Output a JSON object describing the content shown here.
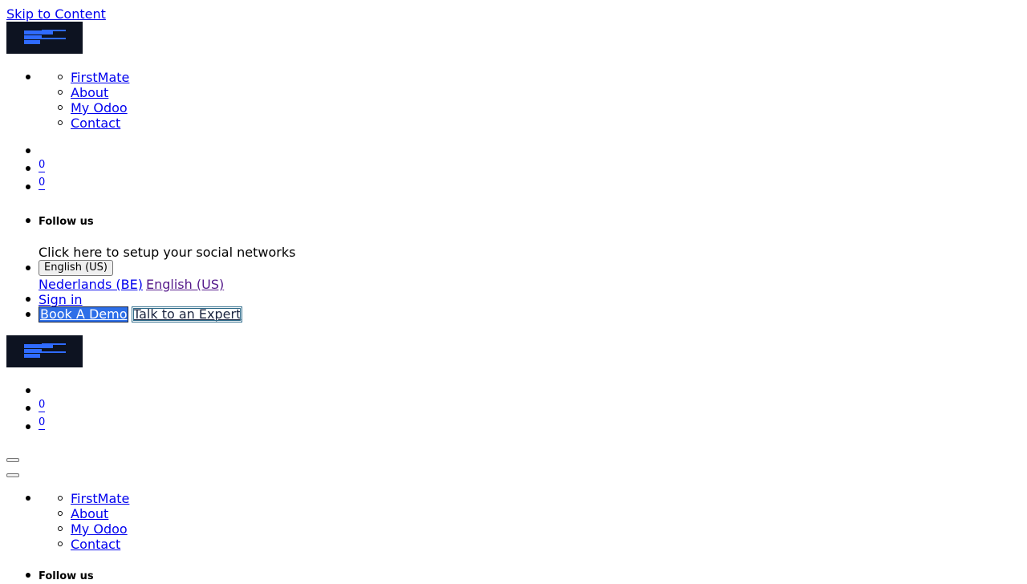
{
  "skip_link": "Skip to Content",
  "logo": {
    "colors": {
      "background": "#0d1321",
      "bars": "#2f6bff"
    }
  },
  "nav": {
    "items": [
      "FirstMate",
      "About",
      "My Odoo",
      "Contact"
    ]
  },
  "cart": {
    "count_1": "0",
    "count_2": "0"
  },
  "social": {
    "heading": "Follow us",
    "setup_text": "Click here to setup your social networks"
  },
  "language": {
    "selected": "English (US)",
    "options": [
      "Nederlands (BE)",
      "English (US)"
    ]
  },
  "account": {
    "sign_in": "Sign in"
  },
  "cta": {
    "book_demo": "Book A Demo",
    "talk_expert": "Talk to an Expert",
    "colors": {
      "primary": "#2d6fe8",
      "dark": "#1b2540"
    }
  },
  "mobile": {
    "cart": {
      "count_1": "0",
      "count_2": "0"
    },
    "nav": {
      "items": [
        "FirstMate",
        "About",
        "My Odoo",
        "Contact"
      ]
    },
    "social_heading": "Follow us"
  }
}
